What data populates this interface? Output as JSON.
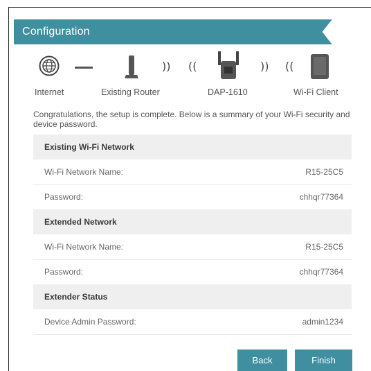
{
  "header": {
    "title": "Configuration"
  },
  "topology": {
    "labels": {
      "internet": "Internet",
      "router": "Existing Router",
      "extender": "DAP-1610",
      "client": "Wi-Fi Client"
    },
    "wave_left": "))",
    "wave_right": "(("
  },
  "intro": "Congratulations, the setup is complete. Below is a summary of your Wi-Fi security and device password.",
  "sections": {
    "existing": {
      "title": "Existing Wi-Fi Network",
      "name_label": "Wi-Fi Network Name:",
      "name_value": "R15-25C5",
      "password_label": "Password:",
      "password_value": "chhqr77364"
    },
    "extended": {
      "title": "Extended Network",
      "name_label": "Wi-Fi Network Name:",
      "name_value": "R15-25C5",
      "password_label": "Password:",
      "password_value": "chhqr77364"
    },
    "status": {
      "title": "Extender Status",
      "admin_label": "Device Admin Password:",
      "admin_value": "admin1234"
    }
  },
  "buttons": {
    "back": "Back",
    "finish": "Finish"
  },
  "colors": {
    "accent": "#3f8fa0",
    "section_bg": "#efefef"
  }
}
